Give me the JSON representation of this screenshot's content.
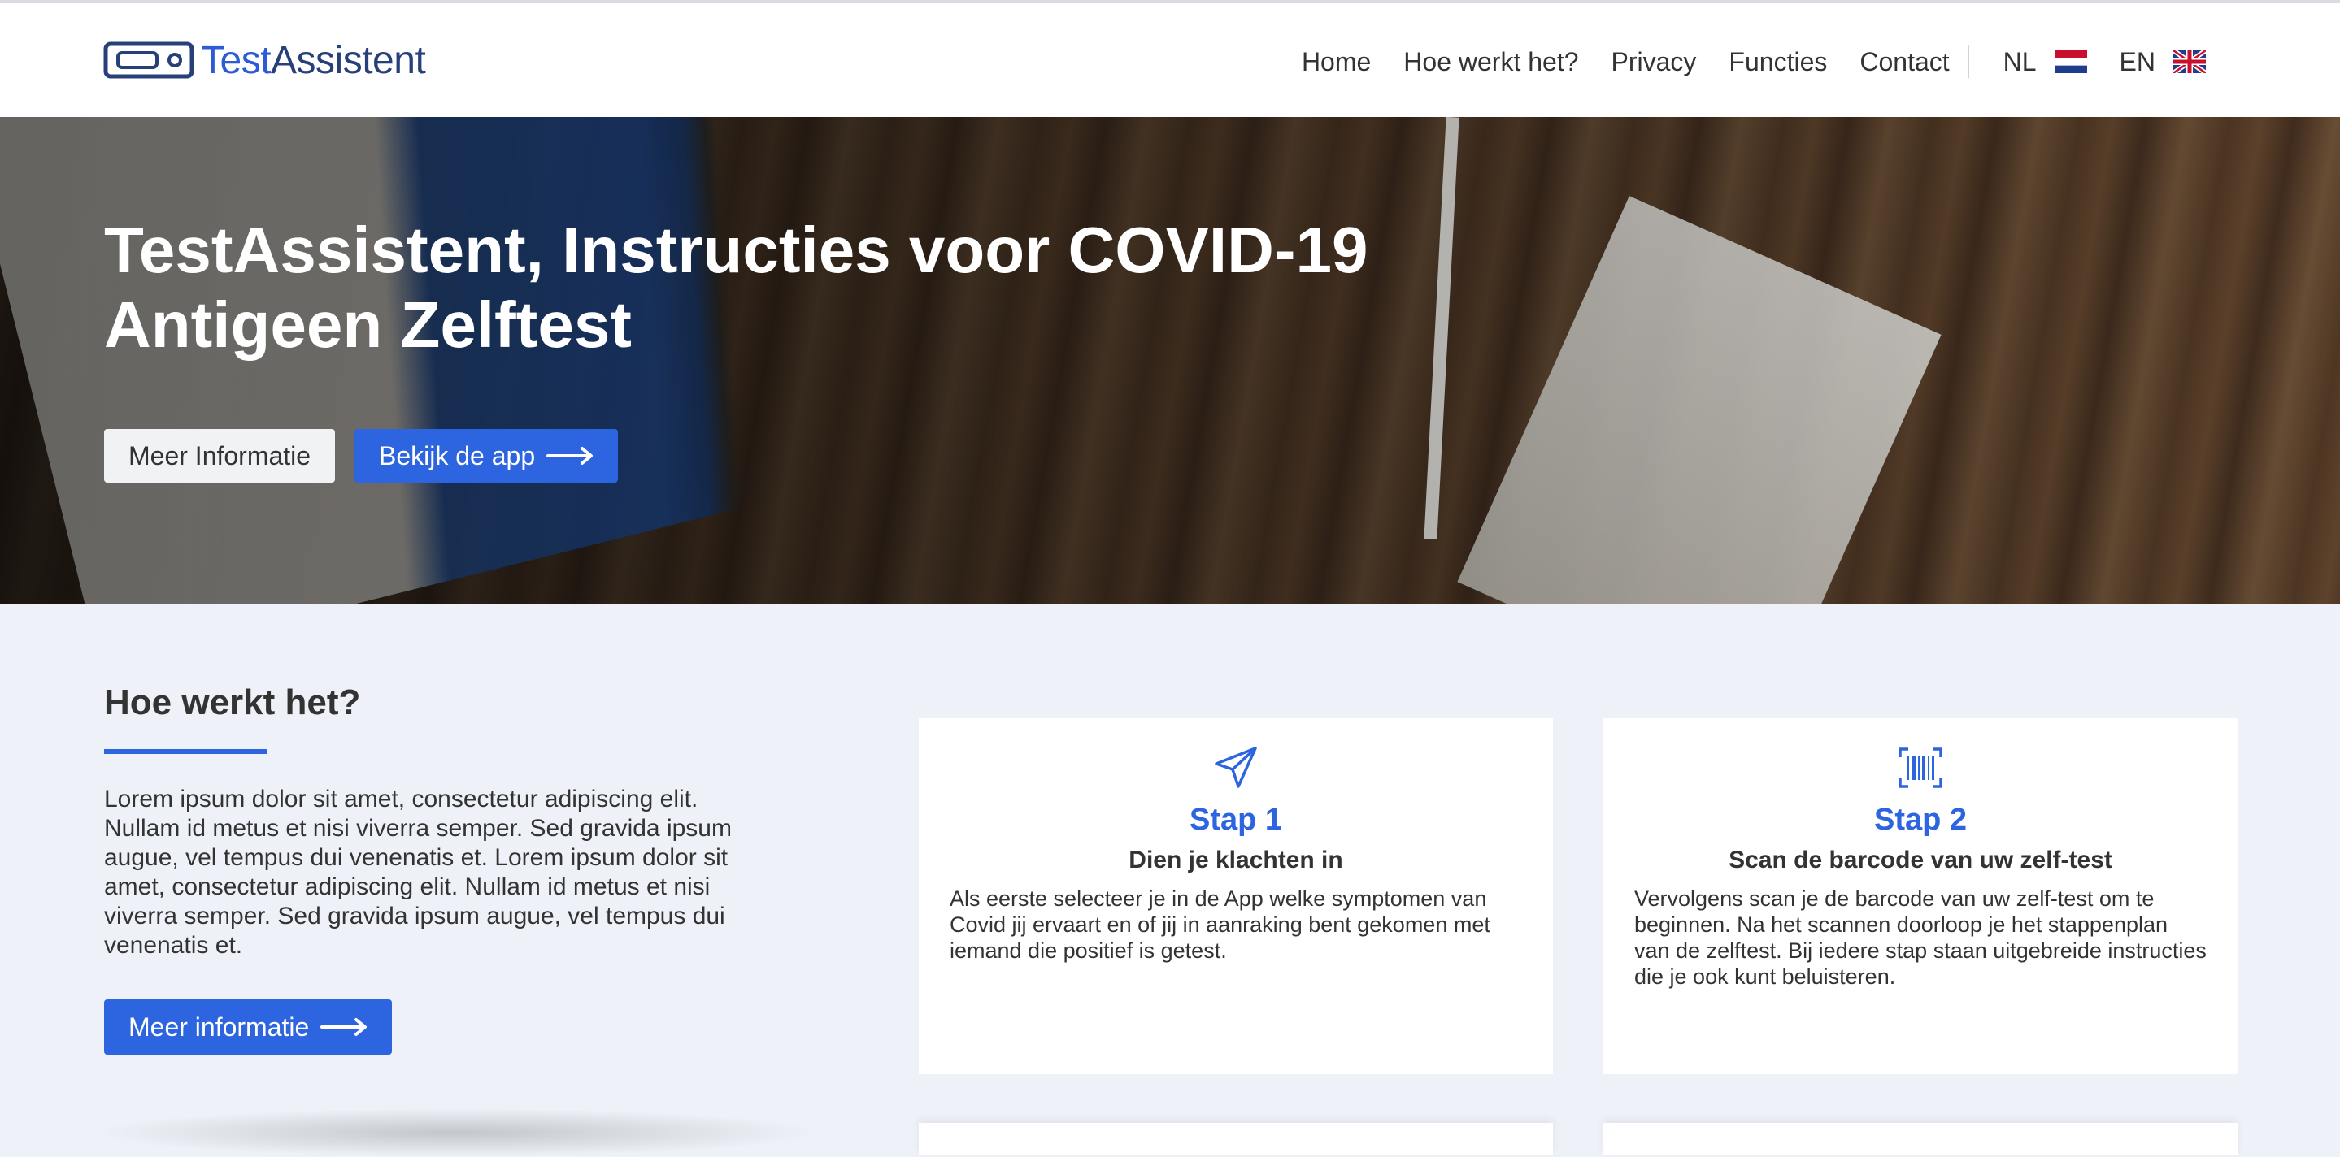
{
  "brand": {
    "name_part1": "Test",
    "name_part2": "Assistent",
    "colors": {
      "primary": "#2d64df",
      "dark": "#27407a"
    }
  },
  "nav": {
    "items": [
      {
        "label": "Home"
      },
      {
        "label": "Hoe werkt het?"
      },
      {
        "label": "Privacy"
      },
      {
        "label": "Functies"
      },
      {
        "label": "Contact"
      }
    ],
    "languages": [
      {
        "code": "NL",
        "flag": "netherlands-flag-icon"
      },
      {
        "code": "EN",
        "flag": "uk-flag-icon"
      }
    ]
  },
  "hero": {
    "title": "TestAssistent, Instructies voor COVID-19 Antigeen Zelftest",
    "button_info": "Meer Informatie",
    "button_app": "Bekijk de app"
  },
  "how": {
    "title": "Hoe werkt het?",
    "lead": "Lorem ipsum dolor sit amet, consectetur adipiscing elit. Nullam id metus et nisi viverra semper. Sed gravida ipsum augue, vel tempus dui venenatis et. Lorem ipsum dolor sit amet, consectetur adipiscing elit. Nullam id metus et nisi viverra semper. Sed gravida ipsum augue, vel tempus dui venenatis et.",
    "button": "Meer informatie",
    "steps": [
      {
        "icon": "paper-plane-icon",
        "title": "Stap 1",
        "subtitle": "Dien je klachten in",
        "text": "Als eerste selecteer je in de App welke symptomen van Covid jij ervaart en of jij in aanraking bent gekomen met iemand die positief is getest."
      },
      {
        "icon": "barcode-scan-icon",
        "title": "Stap 2",
        "subtitle": "Scan de barcode van uw zelf-test",
        "text": "Vervolgens scan je de barcode van uw zelf-test om te beginnen. Na het scannen doorloop je het stappenplan van de zelftest. Bij iedere stap staan uitgebreide instructies die je ook kunt beluisteren."
      }
    ]
  }
}
